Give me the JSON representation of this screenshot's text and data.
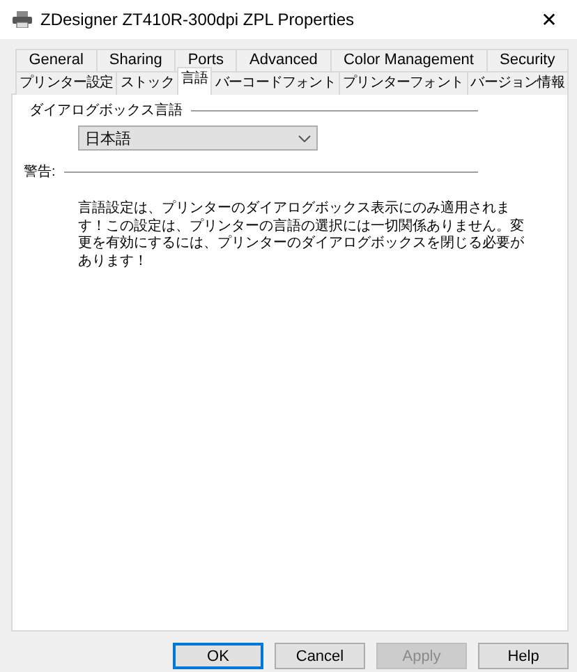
{
  "window": {
    "title": "ZDesigner ZT410R-300dpi ZPL Properties",
    "close": "✕"
  },
  "tab_rows": [
    {
      "tabs": [
        {
          "label": "General",
          "selected": false
        },
        {
          "label": "Sharing",
          "selected": false
        },
        {
          "label": "Ports",
          "selected": false
        },
        {
          "label": "Advanced",
          "selected": false
        },
        {
          "label": "Color Management",
          "selected": false
        },
        {
          "label": "Security",
          "selected": false
        }
      ]
    },
    {
      "tabs": [
        {
          "label": "プリンター設定",
          "selected": false
        },
        {
          "label": "ストック",
          "selected": false
        },
        {
          "label": "言語",
          "selected": true
        },
        {
          "label": "バーコードフォント",
          "selected": false
        },
        {
          "label": "プリンターフォント",
          "selected": false
        },
        {
          "label": "バージョン情報",
          "selected": false
        }
      ]
    }
  ],
  "language_group": {
    "title": "ダイアログボックス言語",
    "dropdown": {
      "value": "日本語"
    }
  },
  "warning_group": {
    "title": "警告:",
    "text": "言語設定は、プリンターのダイアログボックス表示にのみ適用されます！この設定は、プリンターの言語の選択には一切関係ありません。変更を有効にするには、プリンターのダイアログボックスを閉じる必要があります！"
  },
  "buttons": [
    {
      "label": "OK",
      "default": true,
      "disabled": false
    },
    {
      "label": "Cancel",
      "default": false,
      "disabled": false
    },
    {
      "label": "Apply",
      "default": false,
      "disabled": true
    },
    {
      "label": "Help",
      "default": false,
      "disabled": false
    }
  ]
}
